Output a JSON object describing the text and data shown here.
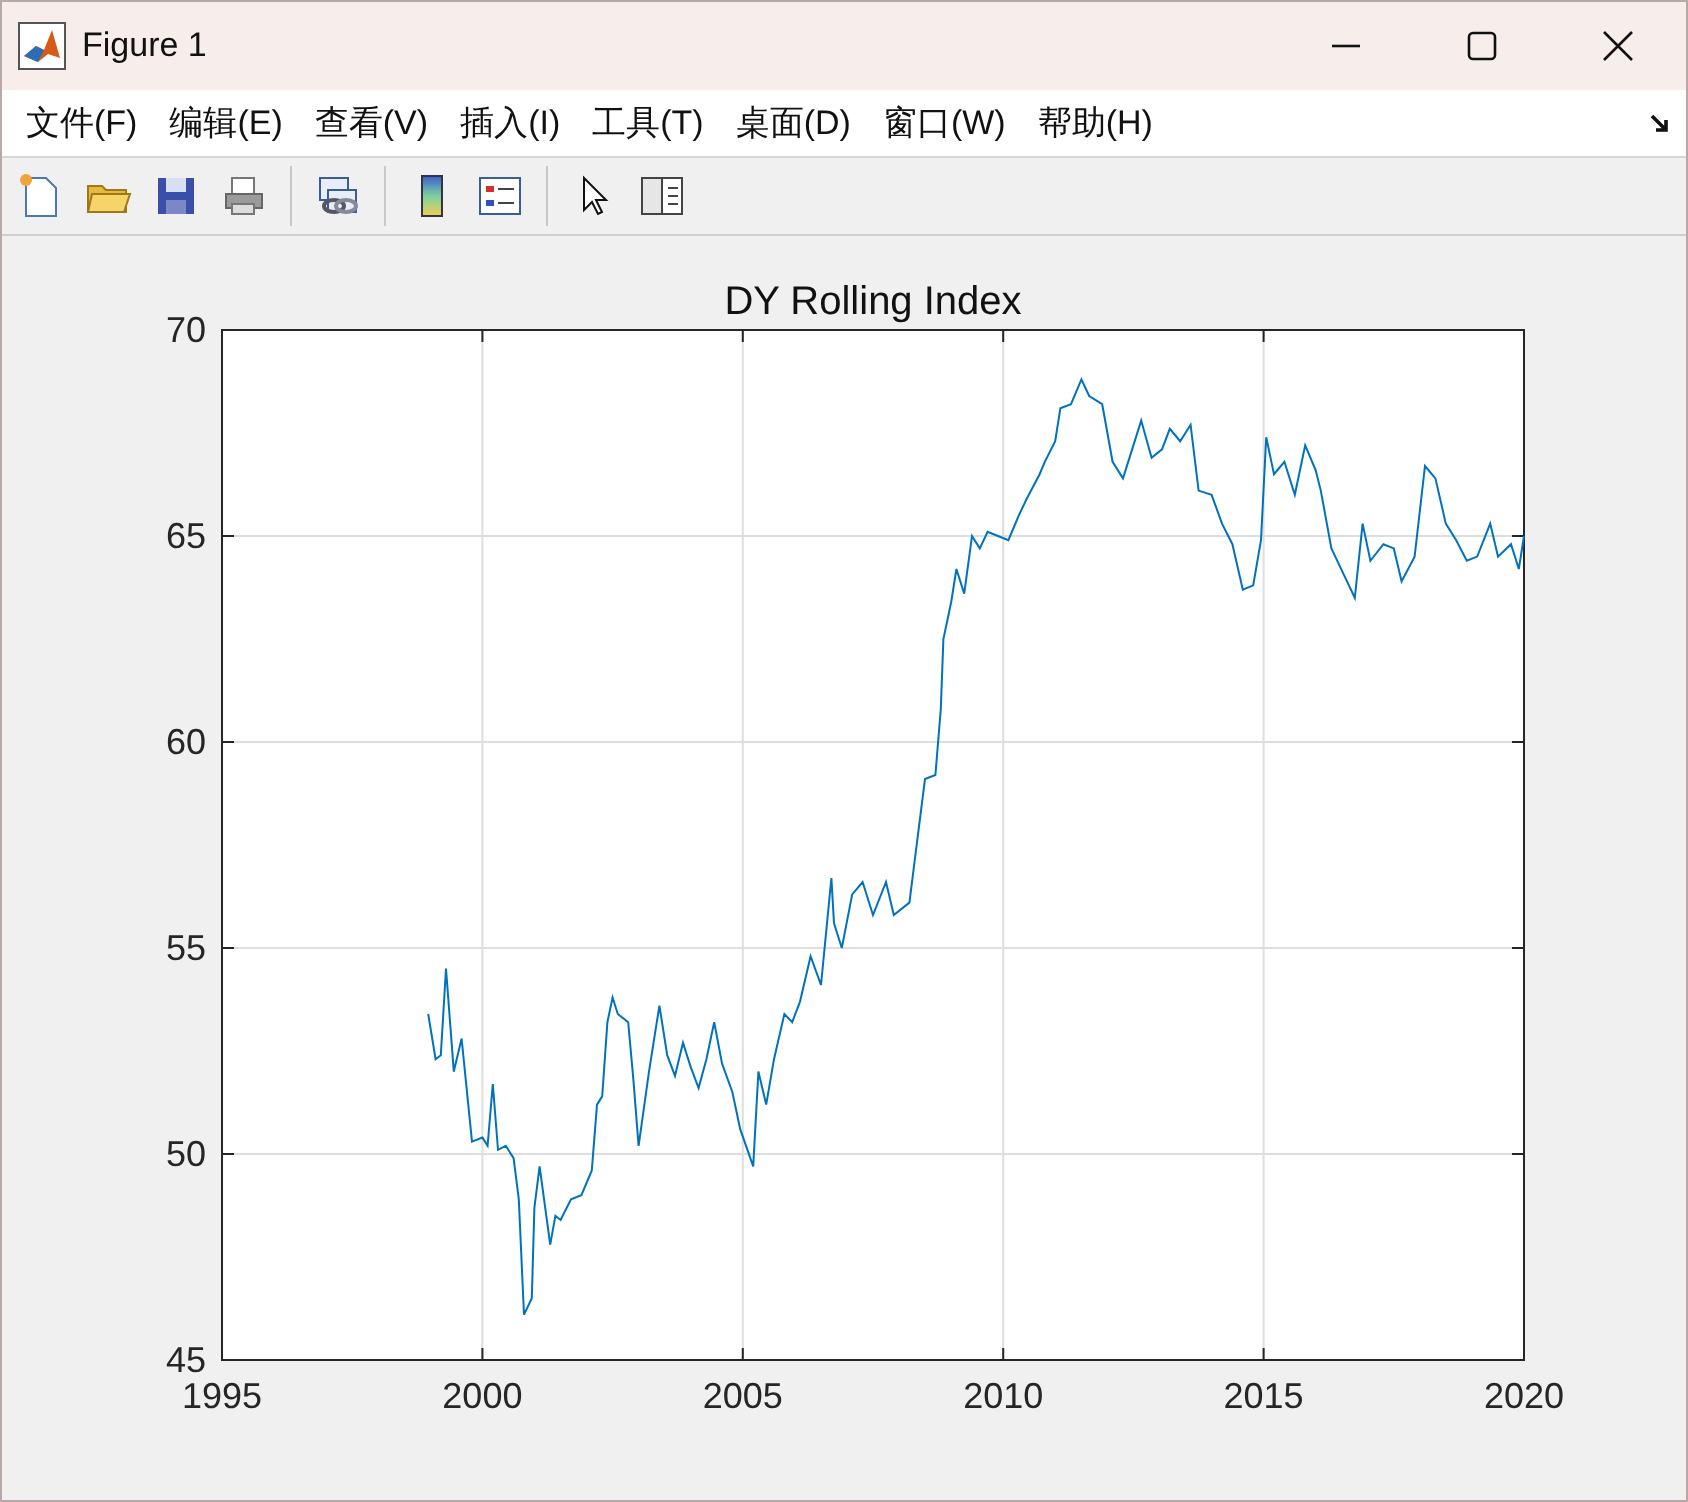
{
  "window": {
    "title": "Figure 1"
  },
  "menu": [
    "文件(F)",
    "编辑(E)",
    "查看(V)",
    "插入(I)",
    "工具(T)",
    "桌面(D)",
    "窗口(W)",
    "帮助(H)"
  ],
  "figure": {
    "chart_data": {
      "type": "line",
      "title": "DY Rolling Index",
      "x": [
        1998.96,
        1999.1,
        1999.2,
        1999.3,
        1999.45,
        1999.6,
        1999.8,
        2000.0,
        2000.1,
        2000.2,
        2000.3,
        2000.45,
        2000.6,
        2000.7,
        2000.8,
        2000.95,
        2001.0,
        2001.1,
        2001.3,
        2001.4,
        2001.5,
        2001.7,
        2001.9,
        2002.1,
        2002.2,
        2002.3,
        2002.4,
        2002.5,
        2002.6,
        2002.8,
        2002.9,
        2003.0,
        2003.2,
        2003.4,
        2003.55,
        2003.7,
        2003.85,
        2004.0,
        2004.15,
        2004.3,
        2004.45,
        2004.6,
        2004.8,
        2004.95,
        2005.2,
        2005.3,
        2005.45,
        2005.6,
        2005.8,
        2005.95,
        2006.1,
        2006.3,
        2006.5,
        2006.7,
        2006.75,
        2006.9,
        2007.1,
        2007.3,
        2007.5,
        2007.75,
        2007.9,
        2008.2,
        2008.3,
        2008.5,
        2008.7,
        2008.8,
        2008.85,
        2009.0,
        2009.1,
        2009.25,
        2009.4,
        2009.55,
        2009.7,
        2009.9,
        2010.1,
        2010.3,
        2010.45,
        2010.7,
        2010.8,
        2011.0,
        2011.1,
        2011.3,
        2011.5,
        2011.65,
        2011.9,
        2012.1,
        2012.3,
        2012.5,
        2012.65,
        2012.85,
        2013.05,
        2013.2,
        2013.4,
        2013.6,
        2013.75,
        2014.0,
        2014.2,
        2014.4,
        2014.6,
        2014.8,
        2014.95,
        2015.05,
        2015.2,
        2015.4,
        2015.6,
        2015.8,
        2016.0,
        2016.1,
        2016.3,
        2016.6,
        2016.75,
        2016.9,
        2017.05,
        2017.3,
        2017.5,
        2017.65,
        2017.9,
        2018.1,
        2018.3,
        2018.5,
        2018.7,
        2018.9,
        2019.1,
        2019.35,
        2019.5,
        2019.75,
        2019.9,
        2020.0
      ],
      "series": [
        {
          "color": "#0072bd",
          "values": [
            53.4,
            52.3,
            52.4,
            54.5,
            52.0,
            52.8,
            50.3,
            50.4,
            50.2,
            51.7,
            50.1,
            50.2,
            49.9,
            48.9,
            46.1,
            46.5,
            48.7,
            49.7,
            47.8,
            48.5,
            48.4,
            48.9,
            49.0,
            49.6,
            51.2,
            51.4,
            53.2,
            53.8,
            53.4,
            53.2,
            51.8,
            50.2,
            52.0,
            53.6,
            52.4,
            51.9,
            52.7,
            52.1,
            51.6,
            52.3,
            53.2,
            52.2,
            51.5,
            50.6,
            49.7,
            52.0,
            51.2,
            52.3,
            53.4,
            53.2,
            53.7,
            54.8,
            54.1,
            56.7,
            55.6,
            55.0,
            56.3,
            56.6,
            55.8,
            56.6,
            55.8,
            56.1,
            57.1,
            59.1,
            59.2,
            60.8,
            62.5,
            63.4,
            64.2,
            63.6,
            65.0,
            64.7,
            65.1,
            65.0,
            64.9,
            65.5,
            65.9,
            66.5,
            66.8,
            67.3,
            68.1,
            68.2,
            68.8,
            68.4,
            68.2,
            66.8,
            66.4,
            67.2,
            67.8,
            66.9,
            67.1,
            67.6,
            67.3,
            67.7,
            66.1,
            66.0,
            65.3,
            64.8,
            63.7,
            63.8,
            64.9,
            67.4,
            66.5,
            66.8,
            66.0,
            67.2,
            66.6,
            66.1,
            64.7,
            63.9,
            63.5,
            65.3,
            64.4,
            64.8,
            64.7,
            63.9,
            64.5,
            66.7,
            66.4,
            65.3,
            64.9,
            64.4,
            64.5,
            65.3,
            64.5,
            64.8,
            64.2,
            65.0
          ]
        }
      ],
      "xlim": [
        1995,
        2020
      ],
      "ylim": [
        45,
        70
      ],
      "xticks": [
        1995,
        2000,
        2005,
        2010,
        2015,
        2020
      ],
      "yticks": [
        45,
        50,
        55,
        60,
        65,
        70
      ],
      "grid": true
    }
  }
}
